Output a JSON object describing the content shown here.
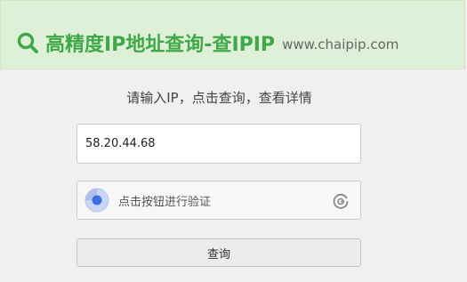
{
  "header": {
    "title": "高精度IP地址查询-查IPIP",
    "domain": "www.chaipip.com",
    "accent_color": "#3fa947",
    "background_color": "#dff0d8",
    "icon": "search-icon"
  },
  "form": {
    "instruction": "请输入IP，点击查询，查看详情",
    "ip_input": {
      "value": "58.20.44.68"
    },
    "captcha": {
      "label": "点击按钮进行验证",
      "indicator_icon": "captcha-dot-icon",
      "refresh_icon": "refresh-icon",
      "indicator_color": "#3b6fe0"
    },
    "query_button_label": "查询"
  }
}
